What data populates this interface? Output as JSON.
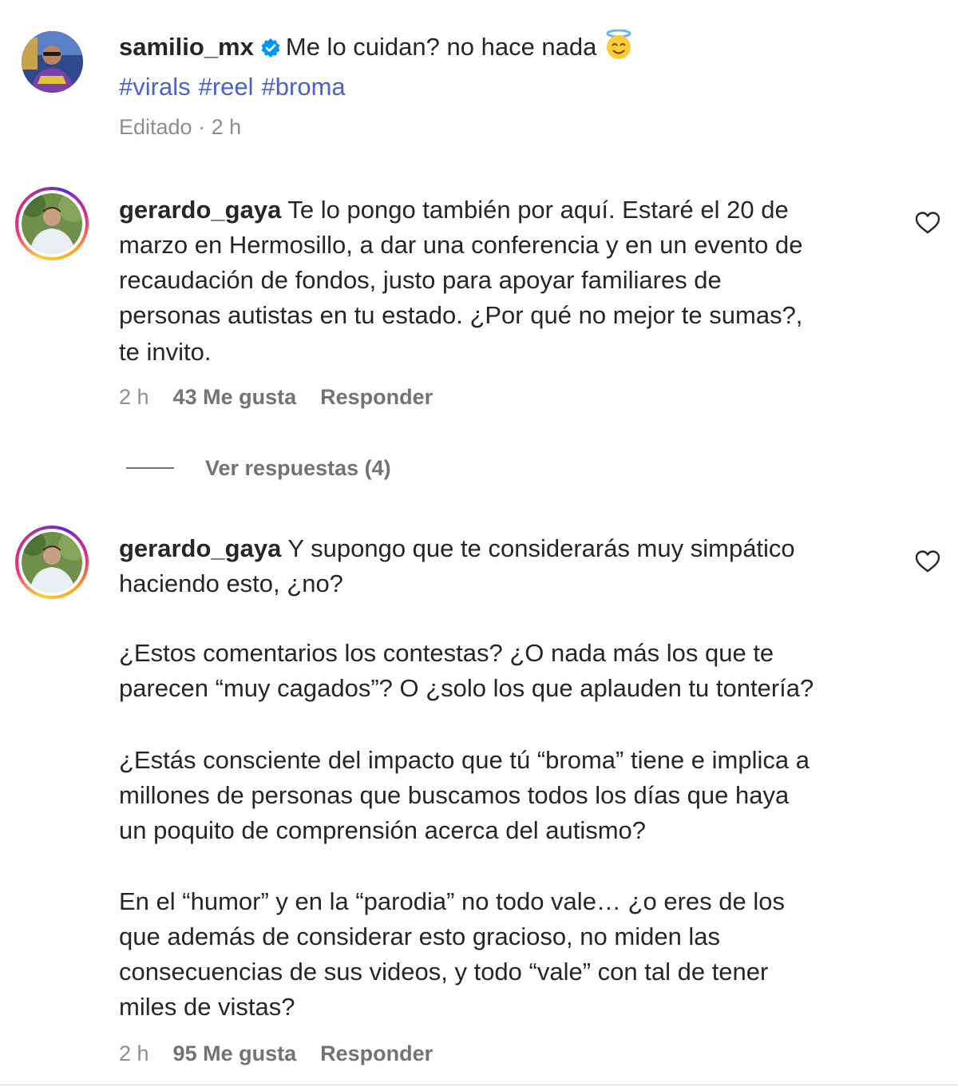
{
  "post": {
    "username": "samilio_mx",
    "verified_icon": "verified-badge-icon",
    "caption": "Me lo cuidan? no hace nada",
    "caption_emoji": "smiling-face-with-halo-icon",
    "hashtags": [
      "#virals",
      "#reel",
      "#broma"
    ],
    "meta": "Editado · 2 h"
  },
  "comments": [
    {
      "username": "gerardo_gaya",
      "lines": [
        " Te lo pongo también por aquí. Estaré el 20 de",
        "marzo en Hermosillo, a dar una conferencia y en un evento de",
        "recaudación de fondos, justo para apoyar familiares de",
        "personas autistas en tu estado. ¿Por qué no mejor te sumas?,",
        "te invito."
      ],
      "time": "2 h",
      "likes": "43 Me gusta",
      "reply_label": "Responder",
      "view_replies": "Ver respuestas (4)"
    },
    {
      "username": "gerardo_gaya",
      "paragraphs": [
        [
          " Y supongo que te considerarás muy simpático",
          "haciendo esto, ¿no?"
        ],
        [
          "¿Estos comentarios los contestas? ¿O nada más los que te",
          "parecen “muy cagados”? O ¿solo los que aplauden tu tontería?"
        ],
        [
          "¿Estás consciente del impacto que tú “broma” tiene e implica a",
          "millones de personas que buscamos todos los días que haya",
          "un poquito de comprensión acerca del autismo?"
        ],
        [
          "En el “humor” y en la “parodia” no todo vale… ¿o eres de los",
          "que además de considerar esto gracioso, no miden las",
          "consecuencias de sus videos, y todo “vale” con tal de tener",
          "miles de vistas?"
        ]
      ],
      "time": "2 h",
      "likes": "95 Me gusta",
      "reply_label": "Responder"
    }
  ],
  "colors": {
    "link": "#4a5fd6",
    "secondary_text": "#8e8e8e",
    "verified": "#0095f6",
    "ring": [
      "#f9ce34",
      "#ee2a7b",
      "#6228d7"
    ]
  }
}
